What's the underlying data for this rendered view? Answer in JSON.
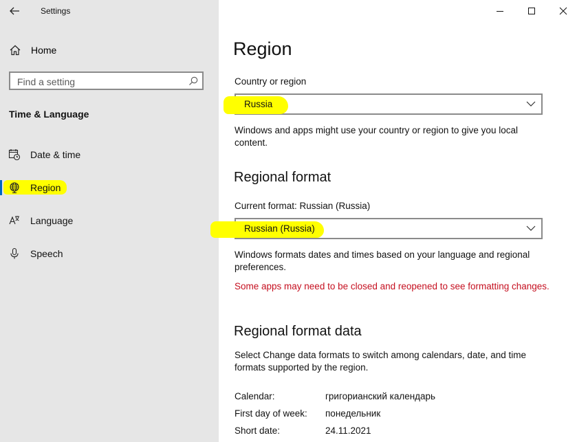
{
  "window": {
    "title": "Settings"
  },
  "sidebar": {
    "home_label": "Home",
    "search_placeholder": "Find a setting",
    "section_title": "Time & Language",
    "items": [
      {
        "label": "Date & time",
        "icon": "calendar-clock-icon"
      },
      {
        "label": "Region",
        "icon": "globe-icon",
        "active": true
      },
      {
        "label": "Language",
        "icon": "language-icon"
      },
      {
        "label": "Speech",
        "icon": "microphone-icon"
      }
    ]
  },
  "main": {
    "title": "Region",
    "country": {
      "label": "Country or region",
      "value": "Russia",
      "description": "Windows and apps might use your country or region to give you local content."
    },
    "regional_format": {
      "heading": "Regional format",
      "current_label": "Current format: Russian (Russia)",
      "value": "Russian (Russia)",
      "description": "Windows formats dates and times based on your language and regional preferences.",
      "warning": "Some apps may need to be closed and reopened to see formatting changes."
    },
    "format_data": {
      "heading": "Regional format data",
      "description": "Select Change data formats to switch among calendars, date, and time formats supported by the region.",
      "rows": [
        {
          "key": "Calendar:",
          "value": "григорианский календарь"
        },
        {
          "key": "First day of week:",
          "value": "понедельник"
        },
        {
          "key": "Short date:",
          "value": "24.11.2021"
        }
      ]
    }
  },
  "colors": {
    "highlight": "#ffff00",
    "warning": "#c50f1f",
    "sidebar_bg": "#e6e6e6"
  }
}
